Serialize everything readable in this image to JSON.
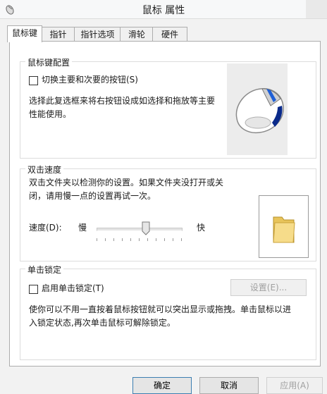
{
  "window": {
    "title": "鼠标 属性"
  },
  "tabs": [
    {
      "label": "鼠标键",
      "active": true
    },
    {
      "label": "指针",
      "active": false
    },
    {
      "label": "指针选项",
      "active": false
    },
    {
      "label": "滑轮",
      "active": false
    },
    {
      "label": "硬件",
      "active": false
    }
  ],
  "button_config": {
    "legend": "鼠标键配置",
    "switch_checkbox": {
      "label": "切换主要和次要的按钮(S)",
      "checked": false
    },
    "description": [
      "选择此复选框来将右按钮设成如选择和拖放等主要",
      "性能使用。"
    ]
  },
  "double_click": {
    "legend": "双击速度",
    "description": [
      "双击文件夹以检测你的设置。如果文件夹没打开或关",
      "闭，请用慢一点的设置再试一次。"
    ],
    "speed_label": "速度(D):",
    "slow_label": "慢",
    "fast_label": "快",
    "speed_level": 0.58
  },
  "click_lock": {
    "legend": "单击锁定",
    "checkbox": {
      "label": "启用单击锁定(T)",
      "checked": false
    },
    "settings_button": "设置(E)...",
    "description": [
      "使你可以不用一直按着鼠标按钮就可以突出显示或拖拽。单击鼠标以进",
      "入锁定状态,再次单击鼠标可解除锁定。"
    ]
  },
  "footer": {
    "ok": "确定",
    "cancel": "取消",
    "apply": "应用(A)"
  },
  "icons": {
    "app": "mouse-properties-icon",
    "close": "close-icon",
    "preview": "mouse-image",
    "test": "folder-icon"
  }
}
